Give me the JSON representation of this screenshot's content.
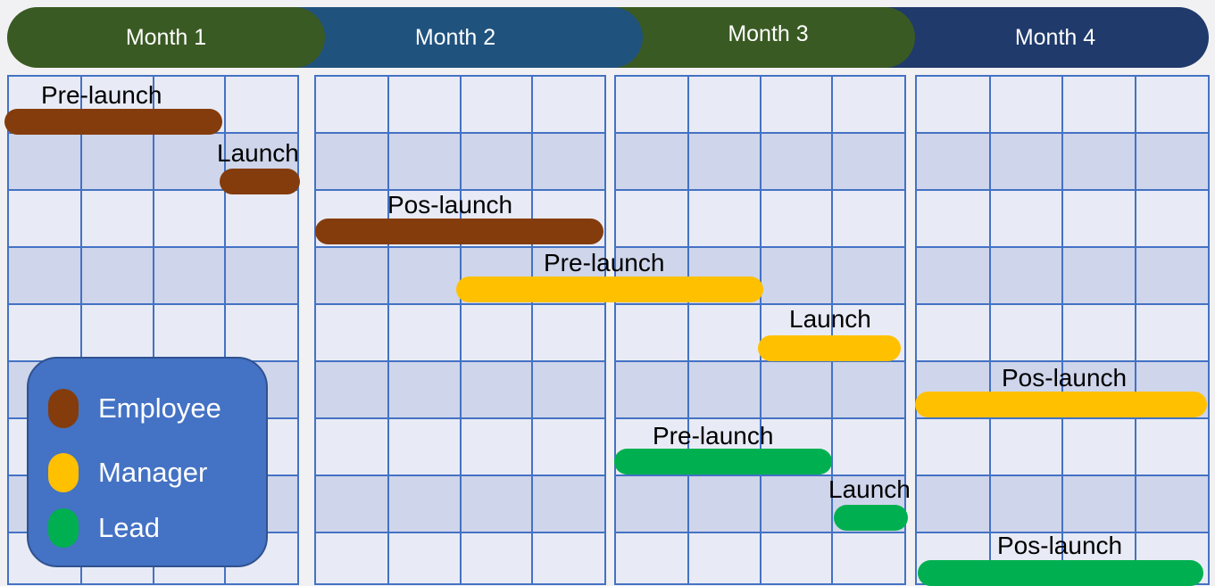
{
  "header": {
    "months": [
      {
        "label": "Month 1",
        "color": "#3a5a23"
      },
      {
        "label": "Month 2",
        "color": "#20527e"
      },
      {
        "label": "Month 3",
        "color": "#3a5a23"
      },
      {
        "label": "Month 4",
        "color": "#1f3a6b"
      }
    ]
  },
  "grid": {
    "line_color": "#4472c4",
    "row_light": "#e8ebf5",
    "row_dark": "#cfd5ea"
  },
  "roles": {
    "employee": {
      "label": "Employee",
      "color": "#843c0c"
    },
    "manager": {
      "label": "Manager",
      "color": "#ffc000"
    },
    "lead": {
      "label": "Lead",
      "color": "#00b050"
    }
  },
  "tasks": [
    {
      "role": "employee",
      "label": "Pre-launch"
    },
    {
      "role": "employee",
      "label": "Launch"
    },
    {
      "role": "employee",
      "label": "Pos-launch"
    },
    {
      "role": "manager",
      "label": "Pre-launch"
    },
    {
      "role": "manager",
      "label": "Launch"
    },
    {
      "role": "manager",
      "label": "Pos-launch"
    },
    {
      "role": "lead",
      "label": "Pre-launch"
    },
    {
      "role": "lead",
      "label": "Launch"
    },
    {
      "role": "lead",
      "label": "Pos-launch"
    }
  ],
  "legend": {
    "items": [
      {
        "label": "Employee",
        "color": "#843c0c"
      },
      {
        "label": "Manager",
        "color": "#ffc000"
      },
      {
        "label": "Lead",
        "color": "#00b050"
      }
    ]
  }
}
